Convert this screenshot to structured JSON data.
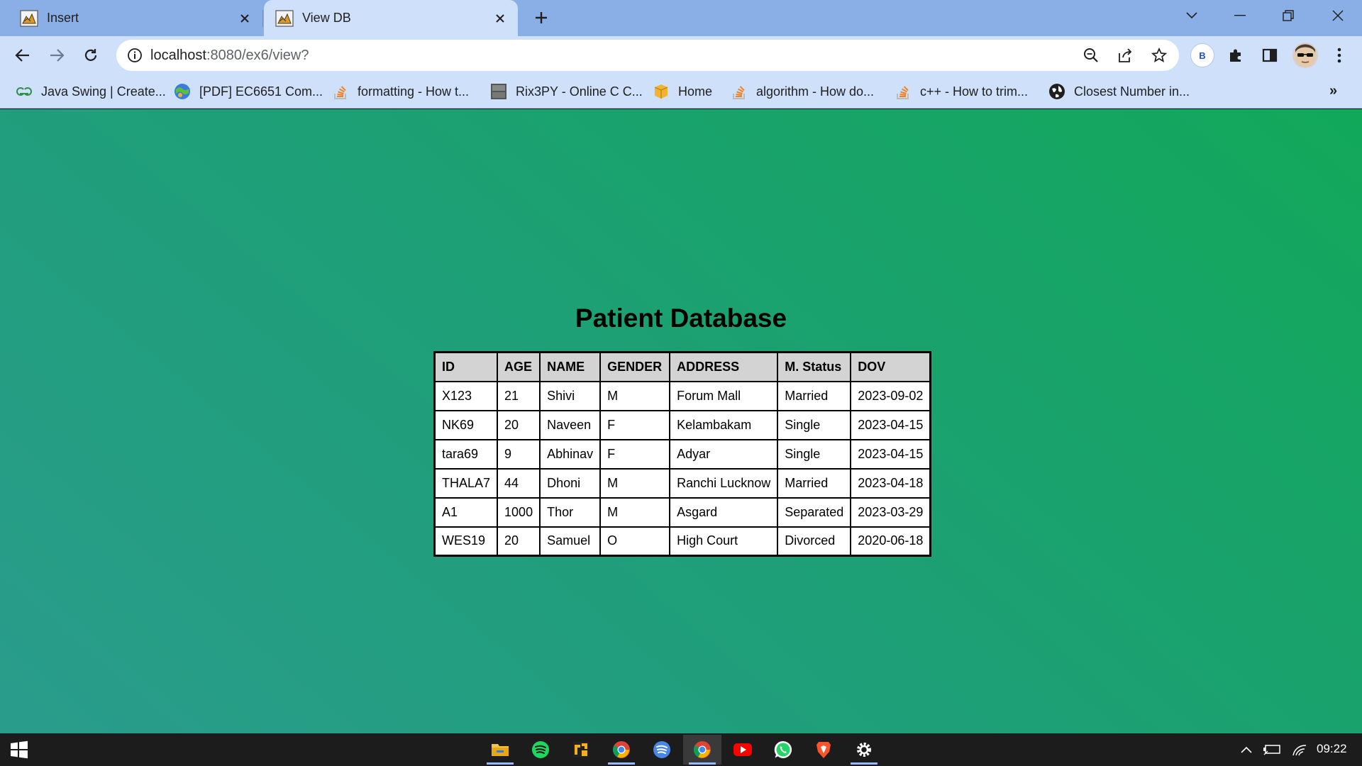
{
  "tabs": [
    {
      "title": "Insert",
      "active": false
    },
    {
      "title": "View DB",
      "active": true
    }
  ],
  "address": {
    "host": "localhost",
    "path": ":8080/ex6/view?"
  },
  "profile_initial": "B",
  "bookmarks": [
    {
      "label": "Java Swing | Create...",
      "icon": "geeksforgeeks-icon"
    },
    {
      "label": "[PDF] EC6651 Com...",
      "icon": "globe-colorful-icon"
    },
    {
      "label": "formatting - How t...",
      "icon": "stackoverflow-icon"
    },
    {
      "label": "Rix3PY - Online C C...",
      "icon": "ideone-icon"
    },
    {
      "label": "Home",
      "icon": "box-icon"
    },
    {
      "label": "algorithm - How do...",
      "icon": "stackoverflow-icon"
    },
    {
      "label": "c++ - How to trim...",
      "icon": "stackoverflow-icon"
    },
    {
      "label": "Closest Number in...",
      "icon": "globe-icon"
    }
  ],
  "page": {
    "heading": "Patient Database",
    "columns": [
      "ID",
      "AGE",
      "NAME",
      "GENDER",
      "ADDRESS",
      "M. Status",
      "DOV"
    ],
    "rows": [
      [
        "X123",
        "21",
        "Shivi",
        "M",
        "Forum Mall",
        "Married",
        "2023-09-02"
      ],
      [
        "NK69",
        "20",
        "Naveen",
        "F",
        "Kelambakam",
        "Single",
        "2023-04-15"
      ],
      [
        "tara69",
        "9",
        "Abhinav",
        "F",
        "Adyar",
        "Single",
        "2023-04-15"
      ],
      [
        "THALA7",
        "44",
        "Dhoni",
        "M",
        "Ranchi Lucknow",
        "Married",
        "2023-04-18"
      ],
      [
        "A1",
        "1000",
        "Thor",
        "M",
        "Asgard",
        "Separated",
        "2023-03-29"
      ],
      [
        "WES19",
        "20",
        "Samuel",
        "O",
        "High Court",
        "Divorced",
        "2020-06-18"
      ]
    ]
  },
  "taskbar": {
    "apps": [
      "file-explorer-icon",
      "spotify-icon",
      "app-icon",
      "chrome-icon",
      "spotify-web-icon",
      "chrome-active-icon",
      "youtube-icon",
      "whatsapp-icon",
      "brave-icon",
      "settings-icon"
    ],
    "clock": "09:22"
  },
  "colors": {
    "tabstrip": "#8aaee6",
    "toolbar": "#cfe0fa",
    "page_gradient_start": "#2a9c8c",
    "page_gradient_end": "#12a85a",
    "table_header_bg": "#d3d3d3"
  }
}
